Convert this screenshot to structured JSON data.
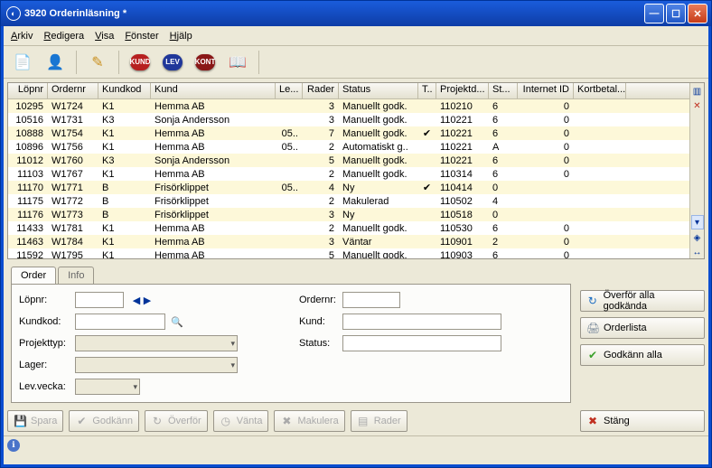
{
  "title": "3920 Orderinläsning *",
  "menu": {
    "arkiv": "Arkiv",
    "redigera": "Redigera",
    "visa": "Visa",
    "fonster": "Fönster",
    "hjalp": "Hjälp"
  },
  "toolbar_badges": {
    "kund": "KUND",
    "lev": "LEV",
    "kont": "KONT"
  },
  "columns": {
    "lopnr": "Löpnr",
    "ordernr": "Ordernr",
    "kundkod": "Kundkod",
    "kund": "Kund",
    "le": "Le...",
    "rader": "Rader",
    "status": "Status",
    "t": "T..",
    "projektd": "Projektd...",
    "st": "St...",
    "internet": "Internet ID",
    "kortbetal": "Kortbetal..."
  },
  "rows": [
    {
      "lopnr": "10295",
      "ordernr": "W1724",
      "kundkod": "K1",
      "kund": "Hemma AB",
      "le": "",
      "rader": "3",
      "status": "Manuellt godk.",
      "t": "",
      "projektd": "110210",
      "st": "6",
      "internet": "0",
      "kortbetal": ""
    },
    {
      "lopnr": "10516",
      "ordernr": "W1731",
      "kundkod": "K3",
      "kund": "Sonja Andersson",
      "le": "",
      "rader": "3",
      "status": "Manuellt godk.",
      "t": "",
      "projektd": "110221",
      "st": "6",
      "internet": "0",
      "kortbetal": ""
    },
    {
      "lopnr": "10888",
      "ordernr": "W1754",
      "kundkod": "K1",
      "kund": "Hemma AB",
      "le": "05..",
      "rader": "7",
      "status": "Manuellt godk.",
      "t": "✔",
      "projektd": "110221",
      "st": "6",
      "internet": "0",
      "kortbetal": ""
    },
    {
      "lopnr": "10896",
      "ordernr": "W1756",
      "kundkod": "K1",
      "kund": "Hemma AB",
      "le": "05..",
      "rader": "2",
      "status": "Automatiskt g..",
      "t": "",
      "projektd": "110221",
      "st": "A",
      "internet": "0",
      "kortbetal": ""
    },
    {
      "lopnr": "11012",
      "ordernr": "W1760",
      "kundkod": "K3",
      "kund": "Sonja Andersson",
      "le": "",
      "rader": "5",
      "status": "Manuellt godk.",
      "t": "",
      "projektd": "110221",
      "st": "6",
      "internet": "0",
      "kortbetal": ""
    },
    {
      "lopnr": "11103",
      "ordernr": "W1767",
      "kundkod": "K1",
      "kund": "Hemma AB",
      "le": "",
      "rader": "2",
      "status": "Manuellt godk.",
      "t": "",
      "projektd": "110314",
      "st": "6",
      "internet": "0",
      "kortbetal": ""
    },
    {
      "lopnr": "11170",
      "ordernr": "W1771",
      "kundkod": "B",
      "kund": "Frisörklippet",
      "le": "05..",
      "rader": "4",
      "status": "Ny",
      "t": "✔",
      "projektd": "110414",
      "st": "0",
      "internet": "",
      "kortbetal": ""
    },
    {
      "lopnr": "11175",
      "ordernr": "W1772",
      "kundkod": "B",
      "kund": "Frisörklippet",
      "le": "",
      "rader": "2",
      "status": "Makulerad",
      "t": "",
      "projektd": "110502",
      "st": "4",
      "internet": "",
      "kortbetal": ""
    },
    {
      "lopnr": "11176",
      "ordernr": "W1773",
      "kundkod": "B",
      "kund": "Frisörklippet",
      "le": "",
      "rader": "3",
      "status": "Ny",
      "t": "",
      "projektd": "110518",
      "st": "0",
      "internet": "",
      "kortbetal": ""
    },
    {
      "lopnr": "11433",
      "ordernr": "W1781",
      "kundkod": "K1",
      "kund": "Hemma AB",
      "le": "",
      "rader": "2",
      "status": "Manuellt godk.",
      "t": "",
      "projektd": "110530",
      "st": "6",
      "internet": "0",
      "kortbetal": ""
    },
    {
      "lopnr": "11463",
      "ordernr": "W1784",
      "kundkod": "K1",
      "kund": "Hemma AB",
      "le": "",
      "rader": "3",
      "status": "Väntar",
      "t": "",
      "projektd": "110901",
      "st": "2",
      "internet": "0",
      "kortbetal": ""
    },
    {
      "lopnr": "11592",
      "ordernr": "W1795",
      "kundkod": "K1",
      "kund": "Hemma AB",
      "le": "",
      "rader": "5",
      "status": "Manuellt godk.",
      "t": "",
      "projektd": "110903",
      "st": "6",
      "internet": "0",
      "kortbetal": ""
    }
  ],
  "tabs": {
    "order": "Order",
    "info": "Info"
  },
  "form": {
    "lopnr_label": "Löpnr:",
    "kundkod_label": "Kundkod:",
    "projekttyp_label": "Projekttyp:",
    "lager_label": "Lager:",
    "levvecka_label": "Lev.vecka:",
    "ordernr_label": "Ordernr:",
    "kund_label": "Kund:",
    "status_label": "Status:",
    "lopnr": "",
    "kundkod": "",
    "projekttyp": "",
    "lager": "",
    "levvecka": "",
    "ordernr": "",
    "kund": "",
    "status": ""
  },
  "right_buttons": {
    "overfor": "Överför alla godkända",
    "orderlista": "Orderlista",
    "godkann": "Godkänn alla"
  },
  "bottom_buttons": {
    "spara": "Spara",
    "godkann": "Godkänn",
    "overfor": "Överför",
    "vanta": "Vänta",
    "makulera": "Makulera",
    "rader": "Rader",
    "stang": "Stäng"
  }
}
